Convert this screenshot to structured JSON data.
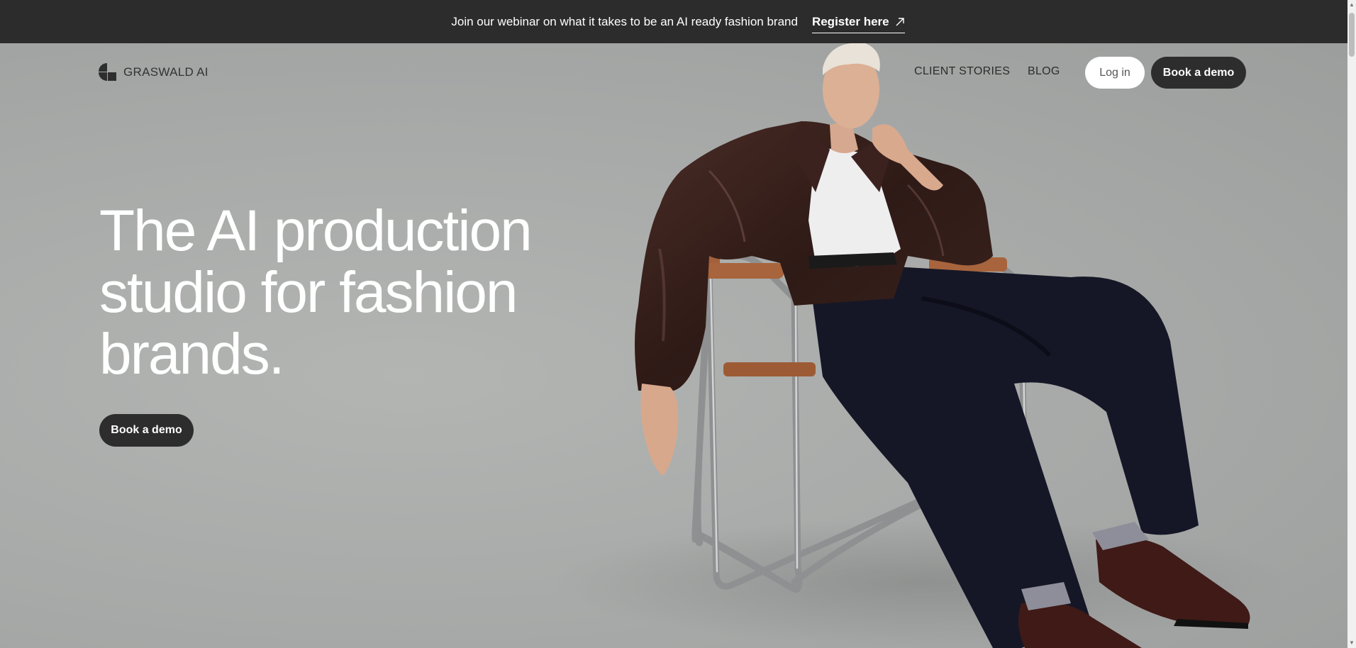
{
  "banner": {
    "text": "Join our webinar on what it takes to be an AI ready fashion brand",
    "link_label": "Register here",
    "link_icon": "arrow-up-right-icon"
  },
  "nav": {
    "brand": "GRASWALD AI",
    "logo_icon": "graswald-logo-icon",
    "links": [
      "CLIENT STORIES",
      "BLOG"
    ],
    "login_label": "Log in",
    "demo_label": "Book a demo"
  },
  "hero": {
    "headline_lines": [
      "The AI production",
      "studio for fashion",
      "brands."
    ],
    "cta_label": "Book a demo"
  },
  "colors": {
    "banner_bg": "#2c2c2c",
    "button_dark": "#2d2d2d",
    "hero_bg": "#a8aaa8"
  }
}
